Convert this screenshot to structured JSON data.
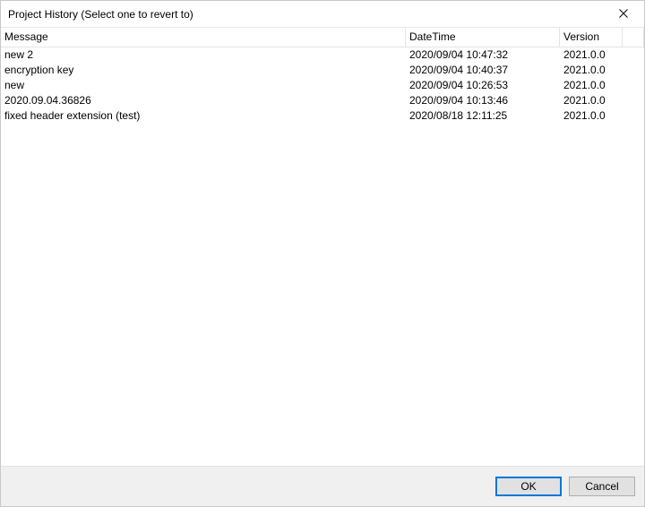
{
  "window": {
    "title": "Project History (Select one to revert to)"
  },
  "columns": {
    "message": "Message",
    "datetime": "DateTime",
    "version": "Version"
  },
  "rows": [
    {
      "message": "new 2",
      "datetime": "2020/09/04 10:47:32",
      "version": "2021.0.0"
    },
    {
      "message": "encryption key",
      "datetime": "2020/09/04 10:40:37",
      "version": "2021.0.0"
    },
    {
      "message": "new",
      "datetime": "2020/09/04 10:26:53",
      "version": "2021.0.0"
    },
    {
      "message": "2020.09.04.36826",
      "datetime": "2020/09/04 10:13:46",
      "version": "2021.0.0"
    },
    {
      "message": "fixed header extension (test)",
      "datetime": "2020/08/18 12:11:25",
      "version": "2021.0.0"
    }
  ],
  "buttons": {
    "ok": "OK",
    "cancel": "Cancel"
  }
}
